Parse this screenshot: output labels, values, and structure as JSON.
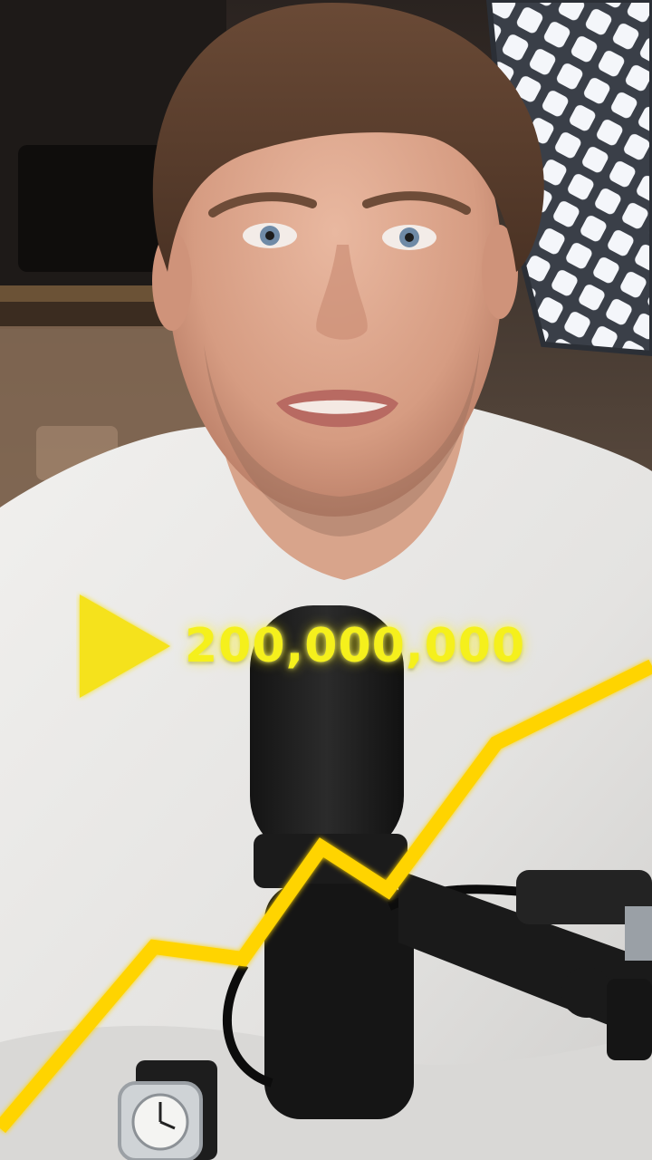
{
  "overlay": {
    "views_count": "200,000,000",
    "icon": "play-icon",
    "accent_color": "#f5e21a"
  },
  "scene": {
    "icons": [
      "microphone-icon",
      "wristwatch-icon",
      "growth-line-icon",
      "softbox-light-icon"
    ]
  }
}
